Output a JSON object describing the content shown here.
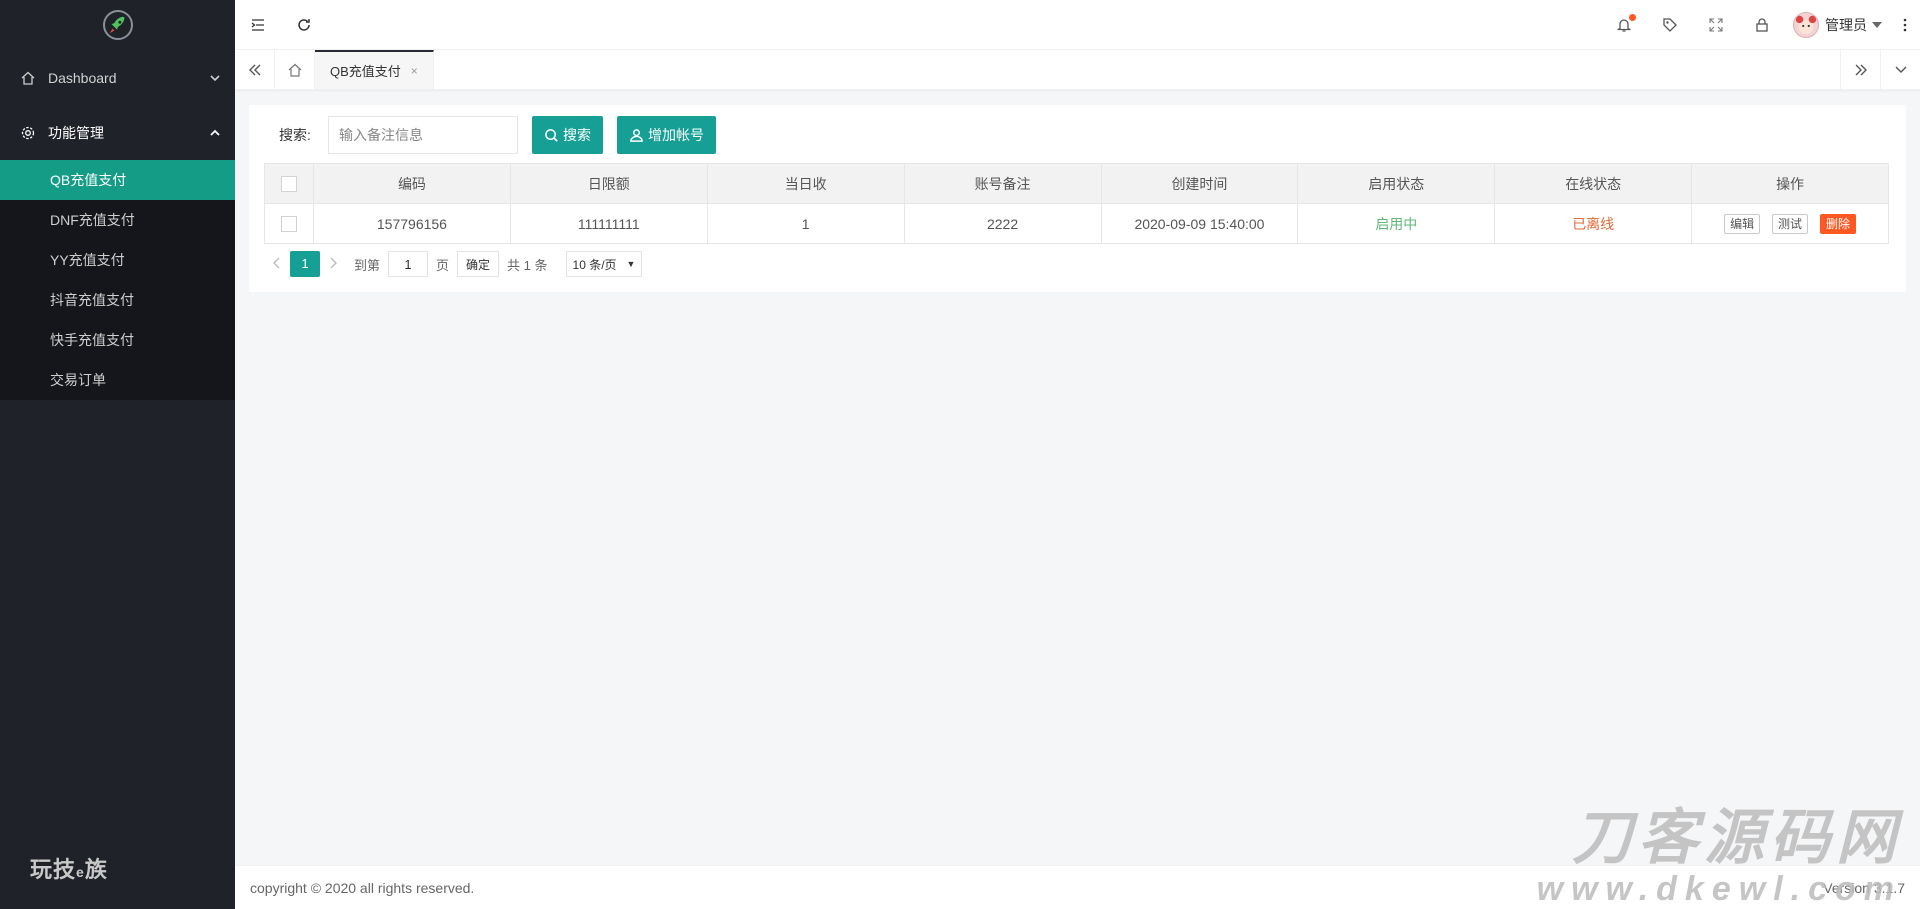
{
  "sidebar": {
    "logo_icon": "rocket-icon",
    "menu": [
      {
        "label": "Dashboard",
        "icon": "home-icon",
        "open": false
      },
      {
        "label": "功能管理",
        "icon": "gear-icon",
        "open": true
      }
    ],
    "sub_items": [
      {
        "label": "QB充值支付",
        "active": true
      },
      {
        "label": "DNF充值支付",
        "active": false
      },
      {
        "label": "YY充值支付",
        "active": false
      },
      {
        "label": "抖音充值支付",
        "active": false
      },
      {
        "label": "快手充值支付",
        "active": false
      },
      {
        "label": "交易订单",
        "active": false
      }
    ],
    "brand_part1": "玩技",
    "brand_part2": "e",
    "brand_part3": "族"
  },
  "header": {
    "user_name": "管理员"
  },
  "tabs": [
    {
      "label": "QB充值支付",
      "close": "×"
    }
  ],
  "search": {
    "label": "搜索:",
    "placeholder": "输入备注信息",
    "search_button": "搜索",
    "add_button": "增加帐号"
  },
  "table": {
    "columns": [
      "编码",
      "日限额",
      "当日收",
      "账号备注",
      "创建时间",
      "启用状态",
      "在线状态",
      "操作"
    ],
    "rows": [
      {
        "code": "157796156",
        "daily_limit": "111111111",
        "today_received": "1",
        "remark": "2222",
        "created_at": "2020-09-09 15:40:00",
        "enabled_status": "启用中",
        "online_status": "已离线",
        "actions": [
          "编辑",
          "测试",
          "删除"
        ]
      }
    ]
  },
  "pagination": {
    "current_page": "1",
    "goto_label": "到第",
    "goto_value": "1",
    "page_unit": "页",
    "confirm": "确定",
    "total": "共 1 条",
    "page_size": "10 条/页"
  },
  "footer": {
    "copyright": "copyright © 2020 all rights reserved.",
    "version": "Version 3.1.7"
  },
  "watermark": {
    "line1": "刀客源码网",
    "line2": "www.dkewl.com"
  },
  "colors": {
    "sidebar_bg": "#20222a",
    "accent": "#16a095",
    "danger": "#ff5722",
    "status_on": "#5fb878",
    "status_off": "#e2693a"
  }
}
